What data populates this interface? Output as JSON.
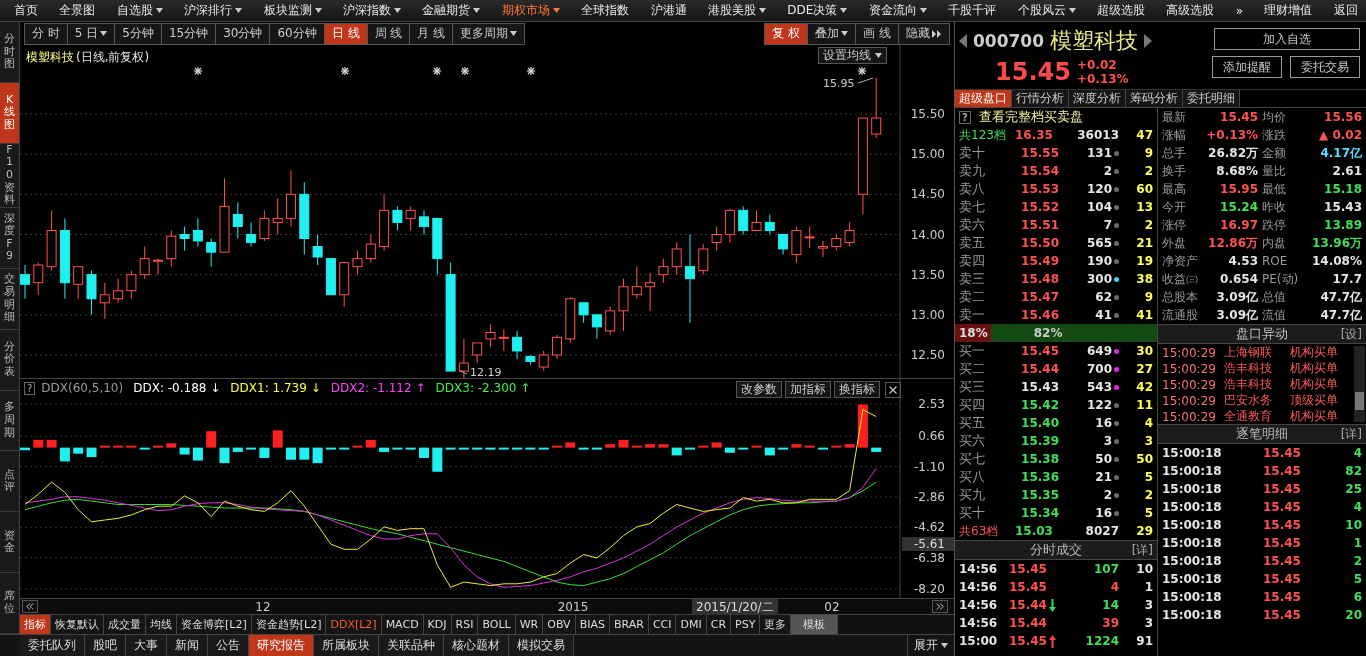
{
  "menu": [
    {
      "label": "首页",
      "dropdown": false,
      "selected": false
    },
    {
      "label": "全景图",
      "dropdown": false,
      "selected": false
    },
    {
      "label": "自选股",
      "dropdown": true,
      "selected": false
    },
    {
      "label": "沪深排行",
      "dropdown": true,
      "selected": false
    },
    {
      "label": "板块监测",
      "dropdown": true,
      "selected": false
    },
    {
      "label": "沪深指数",
      "dropdown": true,
      "selected": false
    },
    {
      "label": "金融期货",
      "dropdown": true,
      "selected": false
    },
    {
      "label": "期权市场",
      "dropdown": true,
      "selected": true
    },
    {
      "label": "全球指数",
      "dropdown": false,
      "selected": false
    },
    {
      "label": "沪港通",
      "dropdown": false,
      "selected": false
    },
    {
      "label": "港股美股",
      "dropdown": true,
      "selected": false
    },
    {
      "label": "DDE决策",
      "dropdown": true,
      "selected": false
    },
    {
      "label": "资金流向",
      "dropdown": true,
      "selected": false
    },
    {
      "label": "千股千评",
      "dropdown": false,
      "selected": false
    },
    {
      "label": "个股风云",
      "dropdown": true,
      "selected": false
    },
    {
      "label": "超级选股",
      "dropdown": false,
      "selected": false
    },
    {
      "label": "高级选股",
      "dropdown": false,
      "selected": false
    },
    {
      "label": "»",
      "dropdown": false,
      "selected": false
    },
    {
      "label": "理财增值",
      "dropdown": false,
      "selected": false
    },
    {
      "label": "返回",
      "dropdown": false,
      "selected": false
    }
  ],
  "side_tabs": [
    {
      "label": "分时图",
      "selected": false
    },
    {
      "label": "K线图",
      "selected": true
    },
    {
      "label": "F10资料",
      "selected": false
    },
    {
      "label": "深度F9",
      "selected": false
    },
    {
      "label": "交易明细",
      "selected": false
    },
    {
      "label": "分价表",
      "selected": false
    },
    {
      "label": "多周期",
      "selected": false
    },
    {
      "label": "点评",
      "selected": false
    },
    {
      "label": "资金",
      "selected": false
    },
    {
      "label": "席位",
      "selected": false
    }
  ],
  "period_tabs": [
    {
      "label": "分 时",
      "dropdown": false,
      "selected": false
    },
    {
      "label": "5 日",
      "dropdown": true,
      "selected": false
    },
    {
      "label": "5分钟",
      "dropdown": false,
      "selected": false
    },
    {
      "label": "15分钟",
      "dropdown": false,
      "selected": false
    },
    {
      "label": "30分钟",
      "dropdown": false,
      "selected": false
    },
    {
      "label": "60分钟",
      "dropdown": false,
      "selected": false
    },
    {
      "label": "日 线",
      "dropdown": false,
      "selected": true
    },
    {
      "label": "周 线",
      "dropdown": false,
      "selected": false
    },
    {
      "label": "月 线",
      "dropdown": false,
      "selected": false
    },
    {
      "label": "更多周期",
      "dropdown": true,
      "selected": false
    }
  ],
  "tools": [
    {
      "label": "复 权",
      "kind": "button",
      "selected": true
    },
    {
      "label": "叠加",
      "kind": "dropdown",
      "selected": false
    },
    {
      "label": "画 线",
      "kind": "button",
      "selected": false
    },
    {
      "label": "隐藏",
      "kind": "collapse",
      "selected": false
    }
  ],
  "price_chart": {
    "title": "模塑科技",
    "subtitle": "(日线,前复权)",
    "ma_button": "设置均线",
    "y_labels": [
      "15.50",
      "15.00",
      "14.50",
      "14.00",
      "13.50",
      "13.00",
      "12.50"
    ],
    "high_label": "15.95",
    "low_label": "12.19"
  },
  "indicator": {
    "help": "?",
    "name": "DDX(60,5,10)",
    "legend": [
      {
        "label": "DDX: -0.188",
        "arrow": "↓",
        "color": "#ffffff"
      },
      {
        "label": "DDX1: 1.739",
        "arrow": "↓",
        "color": "#ffff44"
      },
      {
        "label": "DDX2: -1.112",
        "arrow": "↑",
        "color": "#ff44ff"
      },
      {
        "label": "DDX3: -2.300",
        "arrow": "↑",
        "color": "#44ee44"
      }
    ],
    "buttons": [
      "改参数",
      "加指标",
      "换指标"
    ],
    "cursor_value": "-5.61",
    "chart_data": {
      "type": "line",
      "grid": true,
      "series": [
        {
          "type": "bar",
          "color": "#ff2020",
          "values": [
            null,
            0.45,
            0.45,
            null,
            null,
            null,
            0.05,
            0.05,
            0.08,
            null,
            0.08,
            0.25,
            null,
            null,
            0.95,
            null,
            null,
            null,
            null,
            1.0,
            null,
            null,
            null,
            null,
            null,
            0.1,
            0.45,
            null,
            null,
            null,
            null,
            null,
            null,
            null,
            null,
            null,
            null,
            null,
            null,
            null,
            0.1,
            0.3,
            null,
            null,
            0.2,
            0.45,
            0.1,
            0.2,
            0.2,
            null,
            null,
            0.1,
            0.3,
            null,
            null,
            0.1,
            null,
            null,
            0.2,
            0.1,
            null,
            0.1,
            0.2,
            2.5,
            null
          ]
        },
        {
          "type": "bar",
          "color": "#20f0f0",
          "values": [
            -0.15,
            null,
            null,
            -0.8,
            -0.35,
            -0.55,
            null,
            null,
            null,
            -0.08,
            null,
            null,
            -0.4,
            -0.75,
            null,
            -0.9,
            -0.25,
            -0.1,
            -0.6,
            null,
            -0.7,
            -0.7,
            -0.9,
            -0.1,
            -0.1,
            null,
            null,
            -0.25,
            -0.1,
            -0.1,
            -0.6,
            -1.4,
            -0.1,
            -0.1,
            -0.1,
            -0.1,
            -0.1,
            -0.1,
            -0.1,
            -0.1,
            null,
            null,
            -0.1,
            -0.1,
            null,
            null,
            null,
            null,
            null,
            -0.45,
            -0.1,
            null,
            null,
            -0.3,
            -0.1,
            null,
            -0.45,
            -0.1,
            null,
            null,
            -0.1,
            null,
            null,
            null,
            -0.25
          ]
        },
        {
          "color": "#33dd33",
          "values": [
            -3.6,
            -3.4,
            -3.2,
            -3.05,
            -3.0,
            -3.1,
            -3.2,
            -3.3,
            -3.3,
            -3.3,
            -3.3,
            -3.3,
            -3.35,
            -3.4,
            -3.45,
            -3.5,
            -3.5,
            -3.5,
            -3.5,
            -3.55,
            -3.6,
            -3.7,
            -3.9,
            -4.1,
            -4.3,
            -4.5,
            -4.7,
            -4.85,
            -5.0,
            -5.2,
            -5.4,
            -5.6,
            -5.8,
            -6.0,
            -6.2,
            -6.4,
            -6.6,
            -6.9,
            -7.2,
            -7.5,
            -7.8,
            -7.95,
            -8.0,
            -7.8,
            -7.6,
            -7.3,
            -6.9,
            -6.5,
            -6.1,
            -5.6,
            -5.1,
            -4.7,
            -4.3,
            -3.9,
            -3.6,
            -3.4,
            -3.3,
            -3.25,
            -3.2,
            -3.2,
            -3.15,
            -3.1,
            -2.9,
            -2.5,
            -2.0
          ]
        },
        {
          "color": "#dd33dd",
          "values": [
            -3.2,
            -3.1,
            -3.0,
            -2.85,
            -2.85,
            -2.95,
            -3.05,
            -3.2,
            -3.35,
            -3.5,
            -3.65,
            -3.6,
            -3.4,
            -3.25,
            -3.2,
            -3.2,
            -3.3,
            -3.45,
            -3.55,
            -3.6,
            -3.65,
            -3.7,
            -3.9,
            -4.2,
            -4.5,
            -4.8,
            -5.1,
            -5.3,
            -5.3,
            -5.1,
            -5.0,
            -5.0,
            -5.8,
            -6.8,
            -7.5,
            -7.9,
            -8.1,
            -8.05,
            -8.0,
            -7.85,
            -7.7,
            -7.5,
            -7.2,
            -7.0,
            -6.7,
            -6.4,
            -6.0,
            -5.6,
            -5.1,
            -4.6,
            -4.2,
            -3.8,
            -3.5,
            -3.2,
            -3.0,
            -2.9,
            -2.95,
            -3.05,
            -3.1,
            -3.1,
            -3.1,
            -3.1,
            -2.9,
            -2.3,
            -1.2
          ]
        },
        {
          "color": "#eeee33",
          "values": [
            -3.3,
            -2.7,
            -2.0,
            -2.6,
            -3.6,
            -4.3,
            -4.2,
            -4.1,
            -3.9,
            -3.6,
            -3.4,
            -3.4,
            -2.8,
            -3.2,
            -4.0,
            -3.1,
            -3.4,
            -3.6,
            -3.7,
            -3.2,
            -2.5,
            -3.4,
            -4.5,
            -5.6,
            -5.9,
            -5.9,
            -5.3,
            -4.6,
            -4.8,
            -4.7,
            -4.7,
            -6.8,
            -8.1,
            -7.8,
            -7.9,
            -8.0,
            -7.9,
            -7.9,
            -7.8,
            -7.5,
            -7.3,
            -6.7,
            -6.2,
            -6.4,
            -5.8,
            -5.1,
            -4.6,
            -4.4,
            -3.8,
            -3.3,
            -3.5,
            -3.7,
            -3.6,
            -3.5,
            -2.9,
            -3.1,
            -3.0,
            -3.2,
            -3.2,
            -3.0,
            -3.0,
            -3.0,
            -2.5,
            2.2,
            1.8
          ]
        }
      ],
      "ylim": [
        -8.2,
        2.53
      ],
      "yticks": [
        {
          "value": 2.53,
          "label": "2.53"
        },
        {
          "value": 0.66,
          "label": "0.66"
        },
        {
          "value": -1.1,
          "label": "-1.10"
        },
        {
          "value": -2.86,
          "label": "-2.86"
        },
        {
          "value": -4.62,
          "label": "-4.62"
        },
        {
          "value": -6.38,
          "label": "-6.38"
        },
        {
          "value": -8.2,
          "label": "-8.20"
        }
      ]
    }
  },
  "timeline": {
    "labels": [
      "12",
      "2015",
      "02"
    ],
    "cursor_date": "2015/1/20/二"
  },
  "indicator_tabs": [
    {
      "label": "指标",
      "kind": "header",
      "selected": true
    },
    {
      "label": "恢复默认",
      "kind": "tab",
      "selected": false
    },
    {
      "label": "成交量",
      "kind": "tab",
      "selected": false
    },
    {
      "label": "均线",
      "kind": "tab",
      "selected": false
    },
    {
      "label": "资金博弈[L2]",
      "kind": "tab",
      "selected": false
    },
    {
      "label": "资金趋势[L2]",
      "kind": "tab",
      "selected": false
    },
    {
      "label": "DDX[L2]",
      "kind": "tab",
      "selected": true
    },
    {
      "label": "MACD",
      "kind": "tab",
      "selected": false
    },
    {
      "label": "KDJ",
      "kind": "tab",
      "selected": false
    },
    {
      "label": "RSI",
      "kind": "tab",
      "selected": false
    },
    {
      "label": "BOLL",
      "kind": "tab",
      "selected": false
    },
    {
      "label": "WR",
      "kind": "tab",
      "selected": false
    },
    {
      "label": "OBV",
      "kind": "tab",
      "selected": false
    },
    {
      "label": "BIAS",
      "kind": "tab",
      "selected": false
    },
    {
      "label": "BRAR",
      "kind": "tab",
      "selected": false
    },
    {
      "label": "CCI",
      "kind": "tab",
      "selected": false
    },
    {
      "label": "DMI",
      "kind": "tab",
      "selected": false
    },
    {
      "label": "CR",
      "kind": "tab",
      "selected": false
    },
    {
      "label": "PSY",
      "kind": "tab",
      "selected": false
    },
    {
      "label": "更多",
      "kind": "tab",
      "selected": false
    },
    {
      "label": "模板",
      "kind": "template",
      "selected": false
    }
  ],
  "bottom_tabs": [
    {
      "label": "委托队列",
      "selected": false
    },
    {
      "label": "股吧",
      "selected": false
    },
    {
      "label": "大事",
      "selected": false
    },
    {
      "label": "新闻",
      "selected": false
    },
    {
      "label": "公告",
      "selected": false
    },
    {
      "label": "研究报告",
      "selected": true
    },
    {
      "label": "所属板块",
      "selected": false
    },
    {
      "label": "关联品种",
      "selected": false
    },
    {
      "label": "核心题材",
      "selected": false
    },
    {
      "label": "模拟交易",
      "selected": false
    }
  ],
  "expand_button": "展开",
  "quote": {
    "code": "000700",
    "name": "模塑科技",
    "price": "15.45",
    "change": "+0.02",
    "change_pct": "+0.13%",
    "buttons": [
      "加入自选",
      "添加提醒",
      "委托交易"
    ]
  },
  "quote_tabs": [
    {
      "label": "超级盘口",
      "selected": true
    },
    {
      "label": "行情分析",
      "selected": false
    },
    {
      "label": "深度分析",
      "selected": false
    },
    {
      "label": "筹码分析",
      "selected": false
    },
    {
      "label": "委托明细",
      "selected": false
    }
  ],
  "order_book": {
    "help": "?",
    "title": "查看完整档买卖盘",
    "sell_total": {
      "label": "共123档",
      "price": "16.35",
      "volume": "36013",
      "count": "47"
    },
    "asks": [
      {
        "label": "卖十",
        "price": "15.55",
        "up": true,
        "down": false,
        "volume": "131",
        "count": "9",
        "color": "#6a6a6a"
      },
      {
        "label": "卖九",
        "price": "15.54",
        "up": true,
        "down": false,
        "volume": "2",
        "count": "2",
        "color": "#6a6a6a"
      },
      {
        "label": "卖八",
        "price": "15.53",
        "up": true,
        "down": false,
        "volume": "120",
        "count": "60",
        "color": "#6a6a6a"
      },
      {
        "label": "卖七",
        "price": "15.52",
        "up": true,
        "down": false,
        "volume": "104",
        "count": "13",
        "color": "#6a6a6a"
      },
      {
        "label": "卖六",
        "price": "15.51",
        "up": true,
        "down": false,
        "volume": "7",
        "count": "2",
        "color": "#6a6a6a"
      },
      {
        "label": "卖五",
        "price": "15.50",
        "up": true,
        "down": false,
        "volume": "565",
        "count": "21",
        "color": "#6a6a6a"
      },
      {
        "label": "卖四",
        "price": "15.49",
        "up": true,
        "down": false,
        "volume": "190",
        "count": "19",
        "color": "#6a6a6a"
      },
      {
        "label": "卖三",
        "price": "15.48",
        "up": true,
        "down": false,
        "volume": "300",
        "count": "38",
        "color": "#33ddff"
      },
      {
        "label": "卖二",
        "price": "15.47",
        "up": true,
        "down": false,
        "volume": "62",
        "count": "9",
        "color": "#6a6a6a"
      },
      {
        "label": "卖一",
        "price": "15.46",
        "up": true,
        "down": false,
        "volume": "41",
        "count": "41",
        "color": "#6a6a6a"
      }
    ],
    "ratio": {
      "sell": "18%",
      "buy": "82%",
      "level": 0.18
    },
    "bids": [
      {
        "label": "买一",
        "price": "15.45",
        "up": true,
        "down": false,
        "volume": "649",
        "count": "30",
        "color": "#ee22ee"
      },
      {
        "label": "买二",
        "price": "15.44",
        "up": true,
        "down": false,
        "volume": "700",
        "count": "27",
        "color": "#ee22ee"
      },
      {
        "label": "买三",
        "price": "15.43",
        "up": false,
        "down": false,
        "volume": "543",
        "count": "42",
        "color": "#ee22ee"
      },
      {
        "label": "买四",
        "price": "15.42",
        "up": false,
        "down": true,
        "volume": "122",
        "count": "11",
        "color": "#6a6a6a"
      },
      {
        "label": "买五",
        "price": "15.40",
        "up": false,
        "down": true,
        "volume": "16",
        "count": "4",
        "color": "#6a6a6a"
      },
      {
        "label": "买六",
        "price": "15.39",
        "up": false,
        "down": true,
        "volume": "3",
        "count": "3",
        "color": "#6a6a6a"
      },
      {
        "label": "买七",
        "price": "15.38",
        "up": false,
        "down": true,
        "volume": "50",
        "count": "50",
        "color": "#6a6a6a"
      },
      {
        "label": "买八",
        "price": "15.36",
        "up": false,
        "down": true,
        "volume": "21",
        "count": "5",
        "color": "#6a6a6a"
      },
      {
        "label": "买九",
        "price": "15.35",
        "up": false,
        "down": true,
        "volume": "2",
        "count": "2",
        "color": "#6a6a6a"
      },
      {
        "label": "买十",
        "price": "15.34",
        "up": false,
        "down": true,
        "volume": "16",
        "count": "5",
        "color": "#6a6a6a"
      }
    ],
    "buy_total": {
      "label": "共63档",
      "price": "15.03",
      "volume": "8027",
      "count": "29"
    }
  },
  "stats": [
    {
      "cells": [
        {
          "label": "最新",
          "value": "15.45",
          "color": "#ff5252"
        },
        {
          "label": "均价",
          "value": "15.56",
          "color": "#ff5252"
        }
      ]
    },
    {
      "cells": [
        {
          "label": "涨幅",
          "value": "+0.13%",
          "color": "#ff5252"
        },
        {
          "label": "涨跌",
          "value": "▲ 0.02",
          "color": "#ff5252"
        }
      ]
    },
    {
      "cells": [
        {
          "label": "总手",
          "value": "26.82万",
          "color": "#e6e6e6"
        },
        {
          "label": "金额",
          "value": "4.17亿",
          "color": "#55ddff"
        }
      ]
    },
    {
      "cells": [
        {
          "label": "换手",
          "value": "8.68%",
          "color": "#e6e6e6"
        },
        {
          "label": "量比",
          "value": "2.61",
          "color": "#e6e6e6"
        }
      ]
    },
    {
      "cells": [
        {
          "label": "最高",
          "value": "15.95",
          "color": "#ff5252"
        },
        {
          "label": "最低",
          "value": "15.18",
          "color": "#3ee05a"
        }
      ]
    },
    {
      "cells": [
        {
          "label": "今开",
          "value": "15.24",
          "color": "#3ee05a"
        },
        {
          "label": "昨收",
          "value": "15.43",
          "color": "#e6e6e6"
        }
      ]
    },
    {
      "cells": [
        {
          "label": "涨停",
          "value": "16.97",
          "color": "#ff5252"
        },
        {
          "label": "跌停",
          "value": "13.89",
          "color": "#3ee05a"
        }
      ]
    },
    {
      "cells": [
        {
          "label": "外盘",
          "value": "12.86万",
          "color": "#ff5252"
        },
        {
          "label": "内盘",
          "value": "13.96万",
          "color": "#3ee05a"
        }
      ]
    },
    {
      "cells": [
        {
          "label": "净资产",
          "value": "4.53",
          "color": "#e6e6e6"
        },
        {
          "label": "ROE",
          "value": "14.08%",
          "color": "#e6e6e6"
        }
      ]
    },
    {
      "cells": [
        {
          "label": "收益㈢",
          "value": "0.654",
          "color": "#e6e6e6"
        },
        {
          "label": "PE(动)",
          "value": "17.7",
          "color": "#e6e6e6"
        }
      ]
    },
    {
      "cells": [
        {
          "label": "总股本",
          "value": "3.09亿",
          "color": "#e6e6e6"
        },
        {
          "label": "总值",
          "value": "47.7亿",
          "color": "#e6e6e6"
        }
      ]
    },
    {
      "cells": [
        {
          "label": "流通股",
          "value": "3.09亿",
          "color": "#e6e6e6"
        },
        {
          "label": "流值",
          "value": "47.7亿",
          "color": "#e6e6e6"
        }
      ]
    }
  ],
  "alerts": {
    "title": "盘口异动",
    "more": "[设]",
    "rows": [
      {
        "time": "15:00:29",
        "name": "上海钢联",
        "event": "机构买单"
      },
      {
        "time": "15:00:29",
        "name": "浩丰科技",
        "event": "机构买单"
      },
      {
        "time": "15:00:29",
        "name": "浩丰科技",
        "event": "机构买单"
      },
      {
        "time": "15:00:29",
        "name": "巴安水务",
        "event": "顶级买单"
      },
      {
        "time": "15:00:29",
        "name": "全通教育",
        "event": "机构买单"
      }
    ]
  },
  "minute_trades": {
    "title": "分时成交",
    "more": "[详]",
    "rows": [
      {
        "time": "14:56",
        "price": "15.45",
        "arrow_up": false,
        "arrow_down": false,
        "volume": "107",
        "up": false,
        "count": "10"
      },
      {
        "time": "14:56",
        "price": "15.45",
        "arrow_up": false,
        "arrow_down": false,
        "volume": "4",
        "up": true,
        "count": "1"
      },
      {
        "time": "14:56",
        "price": "15.44",
        "arrow_up": false,
        "arrow_down": true,
        "volume": "14",
        "up": false,
        "count": "3"
      },
      {
        "time": "14:56",
        "price": "15.44",
        "arrow_up": false,
        "arrow_down": false,
        "volume": "39",
        "up": true,
        "count": "3"
      },
      {
        "time": "15:00",
        "price": "15.45",
        "arrow_up": true,
        "arrow_down": false,
        "volume": "1224",
        "up": false,
        "count": "91"
      }
    ]
  },
  "ticks": {
    "title": "逐笔明细",
    "more": "[详]",
    "rows": [
      {
        "time": "15:00:18",
        "price": "15.45",
        "volume": "4"
      },
      {
        "time": "15:00:18",
        "price": "15.45",
        "volume": "82"
      },
      {
        "time": "15:00:18",
        "price": "15.45",
        "volume": "25"
      },
      {
        "time": "15:00:18",
        "price": "15.45",
        "volume": "4"
      },
      {
        "time": "15:00:18",
        "price": "15.45",
        "volume": "10"
      },
      {
        "time": "15:00:18",
        "price": "15.45",
        "volume": "1"
      },
      {
        "time": "15:00:18",
        "price": "15.45",
        "volume": "2"
      },
      {
        "time": "15:00:18",
        "price": "15.45",
        "volume": "5"
      },
      {
        "time": "15:00:18",
        "price": "15.45",
        "volume": "6"
      },
      {
        "time": "15:00:18",
        "price": "15.45",
        "volume": "20"
      }
    ]
  }
}
